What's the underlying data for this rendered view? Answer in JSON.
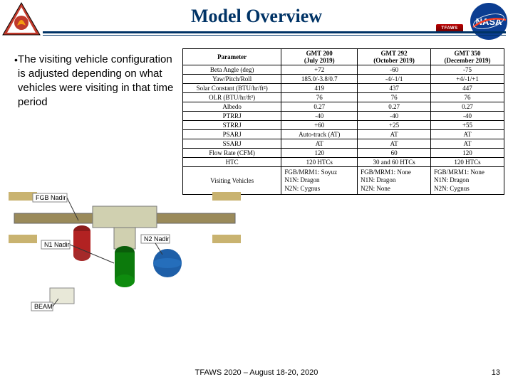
{
  "header": {
    "title": "Model Overview",
    "badge": "TFAWS"
  },
  "bullet": {
    "text": "The visiting vehicle configuration is adjusted depending on what vehicles were visiting in that time period"
  },
  "table": {
    "headers": [
      "Parameter",
      "GMT 200\n(July 2019)",
      "GMT 292\n(October 2019)",
      "GMT 350\n(December 2019)"
    ],
    "rows": [
      [
        "Beta Angle (deg)",
        "+72",
        "-60",
        "-75"
      ],
      [
        "Yaw/Pitch/Roll",
        "185.0/-3.8/0.7",
        "-4/-1/1",
        "+4/-1/+1"
      ],
      [
        "Solar Constant (BTU/hr/ft²)",
        "419",
        "437",
        "447"
      ],
      [
        "OLR (BTU/hr/ft²)",
        "76",
        "76",
        "76"
      ],
      [
        "Albedo",
        "0.27",
        "0.27",
        "0.27"
      ],
      [
        "PTRRJ",
        "-40",
        "-40",
        "-40"
      ],
      [
        "STRRJ",
        "+60",
        "+25",
        "+55"
      ],
      [
        "PSARJ",
        "Auto-track (AT)",
        "AT",
        "AT"
      ],
      [
        "SSARJ",
        "AT",
        "AT",
        "AT"
      ],
      [
        "Flow Rate (CFM)",
        "120",
        "60",
        "120"
      ],
      [
        "HTC",
        "120 HTCs",
        "30 and 60 HTCs",
        "120 HTCs"
      ]
    ],
    "vv_label": "Visiting Vehicles",
    "vv": [
      [
        "FGB/MRM1: Soyuz",
        "N1N: Dragon",
        "N2N: Cygnus"
      ],
      [
        "FGB/MRM1: None",
        "N1N: Dragon",
        "N2N: None"
      ],
      [
        "FGB/MRM1: None",
        "N1N: Dragon",
        "N2N: Cygnus"
      ]
    ]
  },
  "diagram": {
    "labels": {
      "fgb": "FGB Nadir",
      "n1": "N1 Nadir",
      "n2": "N2 Nadir",
      "beam": "BEAM"
    }
  },
  "footer": {
    "text": "TFAWS 2020 – August 18-20, 2020",
    "page": "13"
  }
}
